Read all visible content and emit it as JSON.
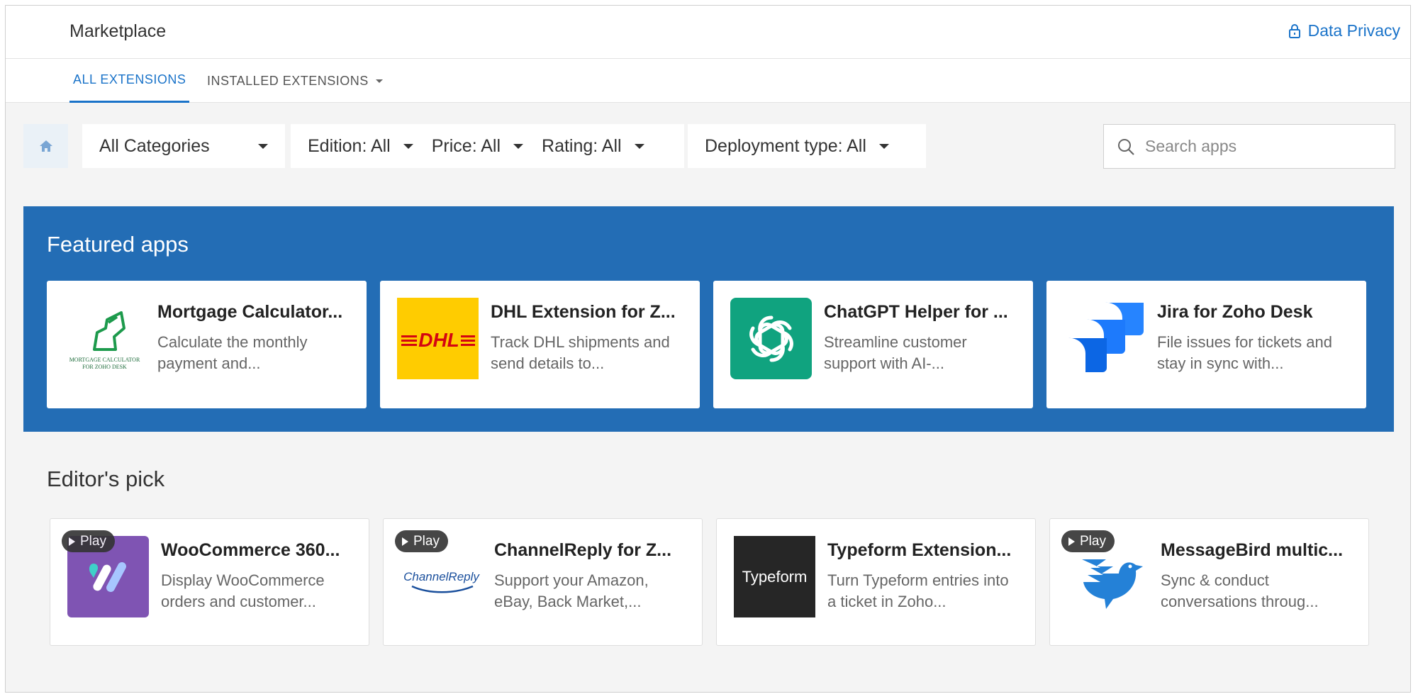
{
  "header": {
    "title": "Marketplace",
    "privacy_label": "Data Privacy"
  },
  "tabs": [
    {
      "label": "ALL EXTENSIONS",
      "active": true
    },
    {
      "label": "INSTALLED EXTENSIONS",
      "active": false
    }
  ],
  "filters": {
    "category": "All Categories",
    "edition": "Edition: All",
    "price": "Price: All",
    "rating": "Rating: All",
    "deployment": "Deployment type: All"
  },
  "search": {
    "placeholder": "Search apps",
    "value": ""
  },
  "featured": {
    "title": "Featured apps",
    "apps": [
      {
        "name": "Mortgage Calculator...",
        "desc": "Calculate the monthly payment and...",
        "icon": "mortgage-calculator-logo",
        "logo_text": "MORTGAGE CALCULATOR FOR ZOHO DESK"
      },
      {
        "name": "DHL Extension for Z...",
        "desc": "Track DHL shipments and send details to...",
        "icon": "dhl-logo",
        "logo_text": "DHL"
      },
      {
        "name": "ChatGPT Helper for ...",
        "desc": "Streamline customer support with AI-...",
        "icon": "chatgpt-logo"
      },
      {
        "name": "Jira for Zoho Desk",
        "desc": "File issues for tickets and stay in sync with...",
        "icon": "jira-logo"
      }
    ]
  },
  "editors": {
    "title": "Editor's pick",
    "play_label": "Play",
    "apps": [
      {
        "name": "WooCommerce 360...",
        "desc": "Display WooCommerce orders and customer...",
        "icon": "woocommerce-logo",
        "play": true
      },
      {
        "name": "ChannelReply for Z...",
        "desc": "Support your Amazon, eBay, Back Market,...",
        "icon": "channelreply-logo",
        "logo_text": "ChannelReply",
        "play": true
      },
      {
        "name": "Typeform Extension...",
        "desc": "Turn Typeform entries into a ticket in Zoho...",
        "icon": "typeform-logo",
        "logo_text": "Typeform",
        "play": false
      },
      {
        "name": "MessageBird multic...",
        "desc": "Sync & conduct conversations throug...",
        "icon": "messagebird-logo",
        "play": true
      }
    ]
  },
  "colors": {
    "accent": "#1a73c9",
    "featured_bg": "#236db5",
    "page_bg": "#f4f4f4",
    "dhl_yellow": "#ffcc00",
    "dhl_red": "#d40511",
    "chatgpt_green": "#10a37f",
    "jira_blue": "#2684ff",
    "woo_purple": "#7f54b3"
  }
}
